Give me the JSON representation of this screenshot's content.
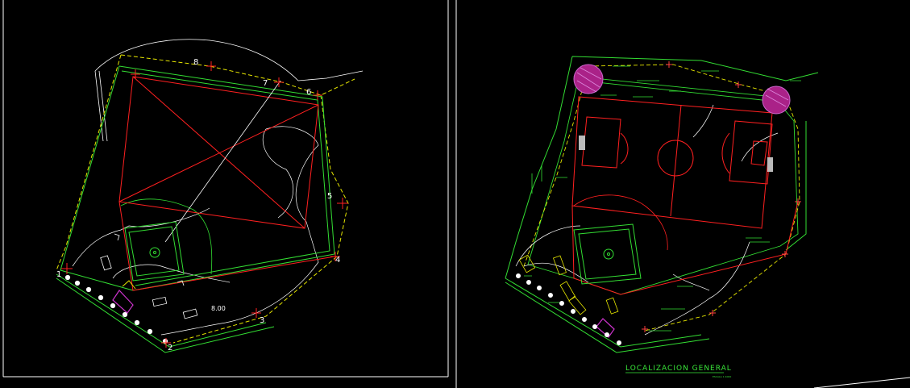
{
  "colors": {
    "background": "#000000",
    "frame": "#ffffff",
    "boundary_red": "#ff2020",
    "wall_green": "#33dd33",
    "dashed_yellow": "#e6e600",
    "contour_white": "#ffffff",
    "accent_magenta": "#cc33cc"
  },
  "left_plan": {
    "vertex_labels": [
      "8",
      "7",
      "6",
      "5",
      "4",
      "3",
      "2",
      "1"
    ],
    "dimension_label": "8.00"
  },
  "right_plan": {
    "title": "LOCALIZACION GENERAL",
    "scale_note": "ESCALA 1:1000"
  }
}
